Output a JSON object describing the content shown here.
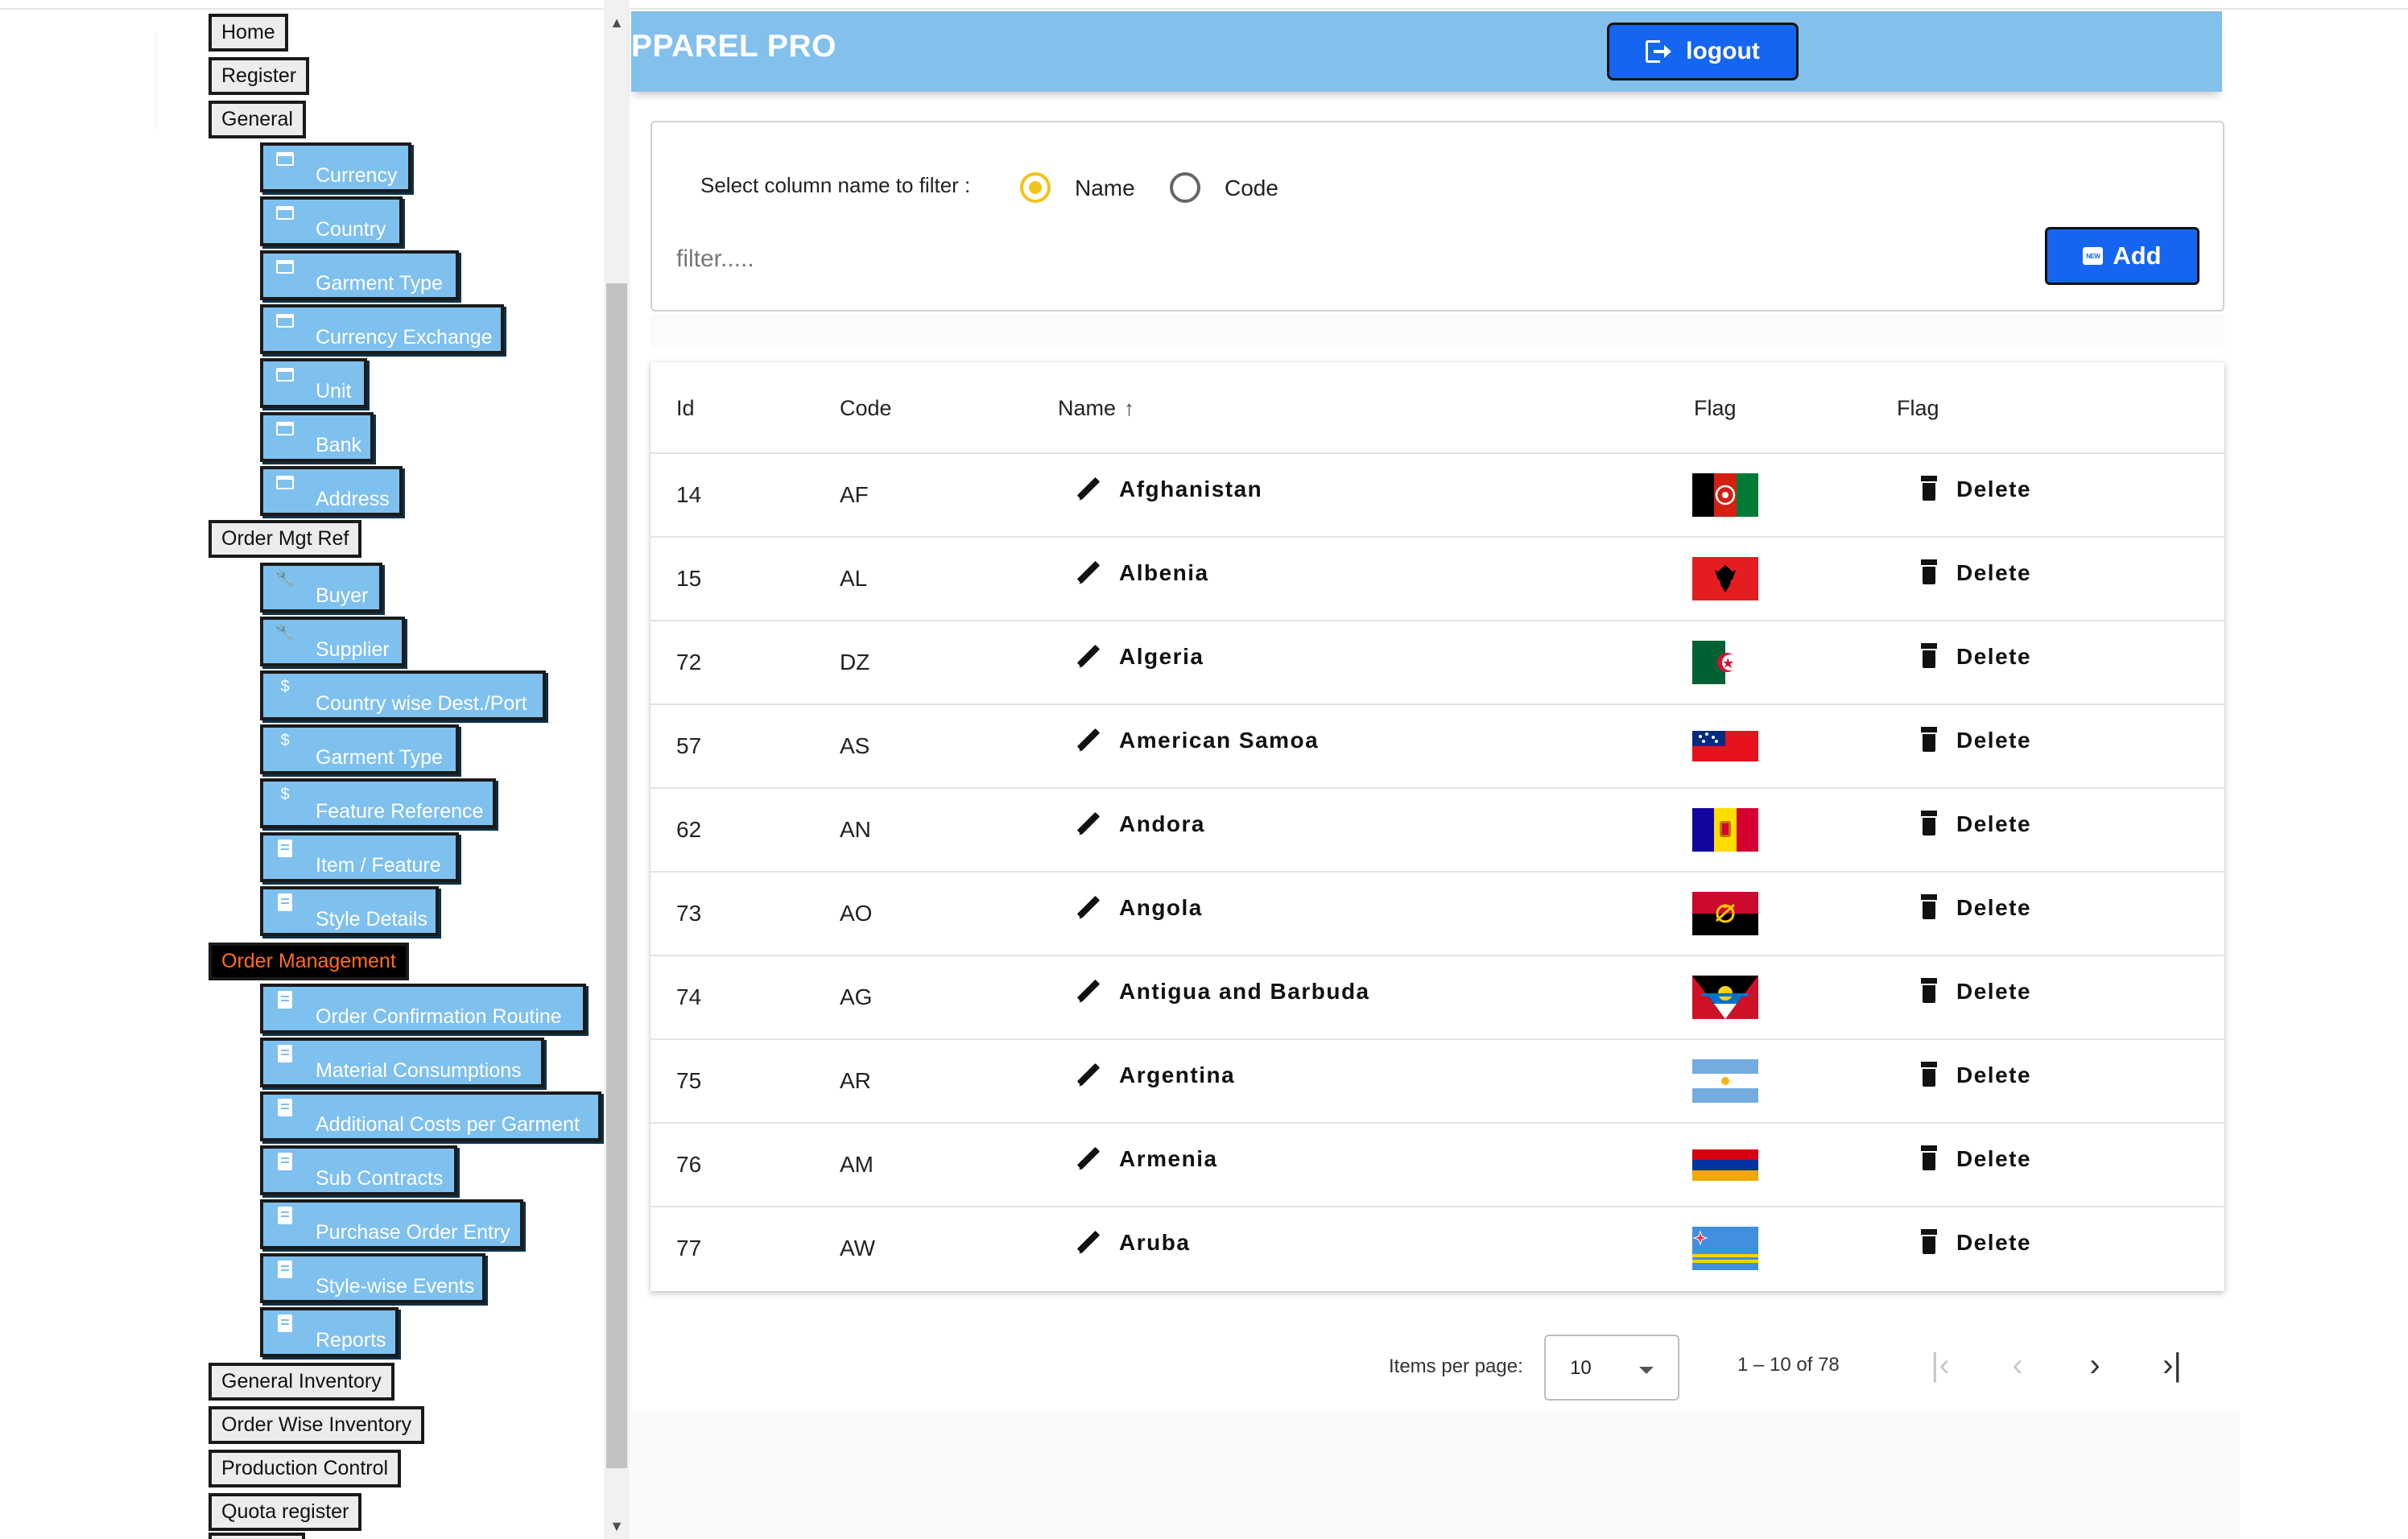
{
  "sidebar": {
    "top_items": [
      {
        "label": "Home"
      },
      {
        "label": "Register"
      },
      {
        "label": "General"
      },
      {
        "label": "Order Mgt Ref"
      },
      {
        "label": "Order Management"
      },
      {
        "label": "General Inventory"
      },
      {
        "label": "Order Wise Inventory"
      },
      {
        "label": "Production Control"
      },
      {
        "label": "Quota register"
      }
    ],
    "general_items": [
      {
        "label": "Currency",
        "icon": "folder-icon"
      },
      {
        "label": "Country",
        "icon": "folder-icon"
      },
      {
        "label": "Garment Type",
        "icon": "folder-icon"
      },
      {
        "label": "Currency Exchange",
        "icon": "folder-icon"
      },
      {
        "label": "Unit",
        "icon": "folder-icon"
      },
      {
        "label": "Bank",
        "icon": "folder-icon"
      },
      {
        "label": "Address",
        "icon": "folder-icon"
      }
    ],
    "order_mgt_ref_items": [
      {
        "label": "Buyer",
        "icon": "wrench-icon"
      },
      {
        "label": "Supplier",
        "icon": "wrench-icon"
      },
      {
        "label": "Country wise Dest./Port",
        "icon": "dollar-icon"
      },
      {
        "label": "Garment Type",
        "icon": "dollar-icon"
      },
      {
        "label": "Feature Reference",
        "icon": "dollar-icon"
      },
      {
        "label": "Item / Feature",
        "icon": "clipboard-icon"
      },
      {
        "label": "Style Details",
        "icon": "clipboard-icon"
      }
    ],
    "order_management_items": [
      {
        "label": "Order Confirmation Routine",
        "icon": "clipboard-icon"
      },
      {
        "label": "Material Consumptions",
        "icon": "clipboard-icon"
      },
      {
        "label": "Additional Costs per Garment",
        "icon": "clipboard-icon"
      },
      {
        "label": "Sub Contracts",
        "icon": "clipboard-icon"
      },
      {
        "label": "Purchase Order Entry",
        "icon": "clipboard-icon"
      },
      {
        "label": "Style-wise Events",
        "icon": "clipboard-icon"
      },
      {
        "label": "Reports",
        "icon": "clipboard-icon"
      }
    ],
    "active_item": "Order Management"
  },
  "header": {
    "brand": "PPAREL PRO",
    "logout_label": "logout",
    "logout_icon": "logout-icon",
    "background_color": "#84c0ec"
  },
  "filter": {
    "label": "Select column name to filter :",
    "options": [
      "Name",
      "Code"
    ],
    "selected": "Name",
    "placeholder": "filter.....",
    "value": "",
    "add_label": "Add",
    "add_icon": "new-icon"
  },
  "table": {
    "columns": [
      "Id",
      "Code",
      "Name",
      "Flag",
      "Flag"
    ],
    "sort_column": "Name",
    "sort_direction": "ascending",
    "delete_label": "Delete",
    "rows": [
      {
        "id": "14",
        "code": "AF",
        "name": "Afghanistan",
        "flag": "Afghanistan"
      },
      {
        "id": "15",
        "code": "AL",
        "name": "Albenia",
        "flag": "Albania"
      },
      {
        "id": "72",
        "code": "DZ",
        "name": "Algeria",
        "flag": "Algeria"
      },
      {
        "id": "57",
        "code": "AS",
        "name": "American Samoa",
        "flag": "American Samoa"
      },
      {
        "id": "62",
        "code": "AN",
        "name": "Andora",
        "flag": "Andorra"
      },
      {
        "id": "73",
        "code": "AO",
        "name": "Angola",
        "flag": "Angola"
      },
      {
        "id": "74",
        "code": "AG",
        "name": "Antigua and Barbuda",
        "flag": "Antigua and Barbuda"
      },
      {
        "id": "75",
        "code": "AR",
        "name": "Argentina",
        "flag": "Argentina"
      },
      {
        "id": "76",
        "code": "AM",
        "name": "Armenia",
        "flag": "Armenia"
      },
      {
        "id": "77",
        "code": "AW",
        "name": "Aruba",
        "flag": "Aruba"
      }
    ]
  },
  "paginator": {
    "items_per_page_label": "Items per page:",
    "page_size": "10",
    "range_label": "1 – 10 of 78"
  },
  "colors": {
    "accent_button": "#1565f0",
    "submenu_bg": "#7ec0ee",
    "active_menu_text": "#ff6d1f",
    "radio_selected": "#f2c417"
  }
}
